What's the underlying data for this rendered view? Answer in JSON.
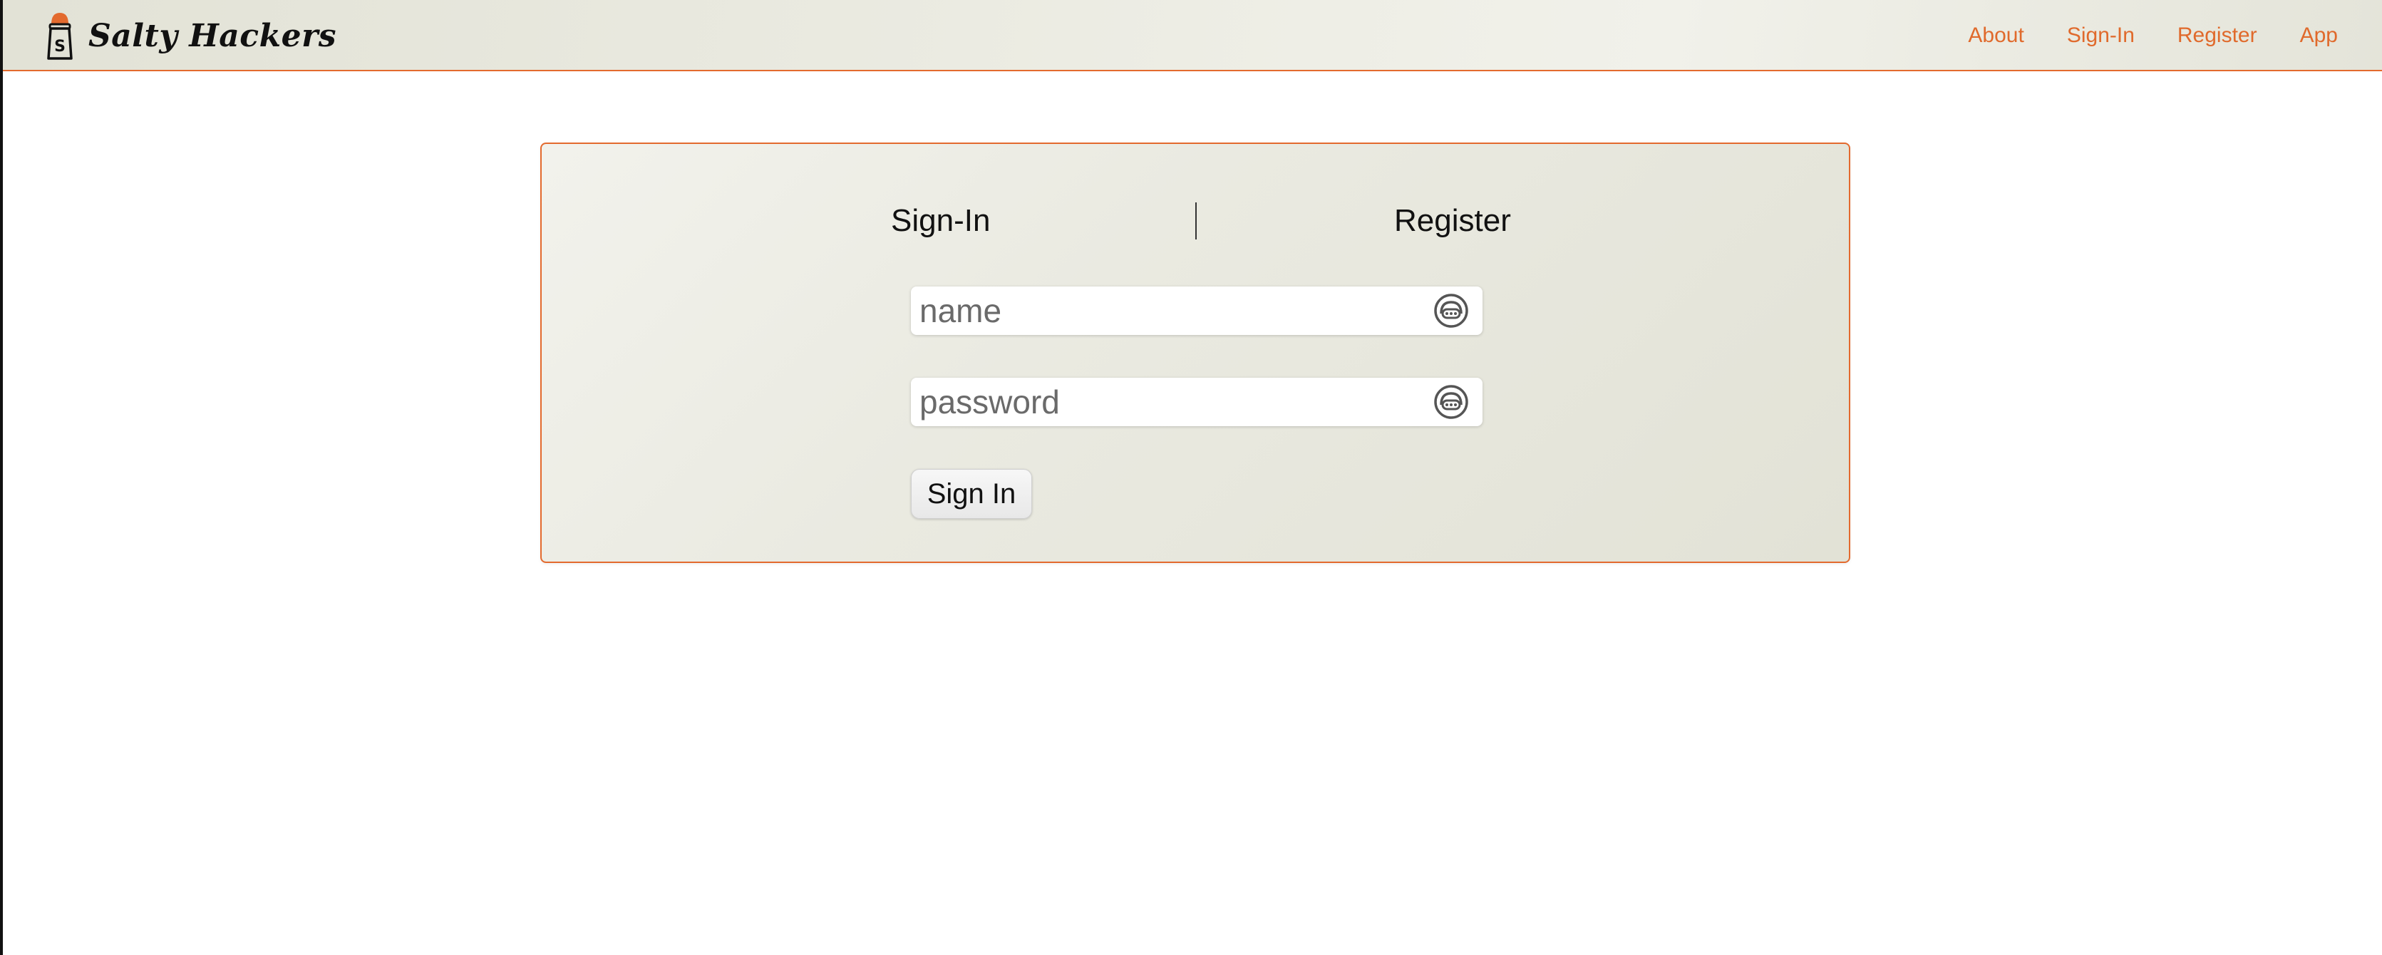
{
  "header": {
    "brand_name": "Salty Hackers",
    "logo_icon": "salt-shaker-icon",
    "nav": [
      {
        "label": "About"
      },
      {
        "label": "Sign-In"
      },
      {
        "label": "Register"
      },
      {
        "label": "App"
      }
    ]
  },
  "auth_card": {
    "tabs": {
      "signin_label": "Sign-In",
      "register_label": "Register"
    },
    "fields": {
      "name": {
        "placeholder": "name",
        "value": "",
        "icon": "password-manager-icon"
      },
      "password": {
        "placeholder": "password",
        "value": "",
        "icon": "password-manager-icon"
      }
    },
    "submit_label": "Sign In"
  },
  "colors": {
    "accent": "#e36a2e",
    "nav_link": "#e06a2c",
    "header_bg": "#ecece3",
    "card_bg": "#e8e8de",
    "text": "#111111"
  }
}
